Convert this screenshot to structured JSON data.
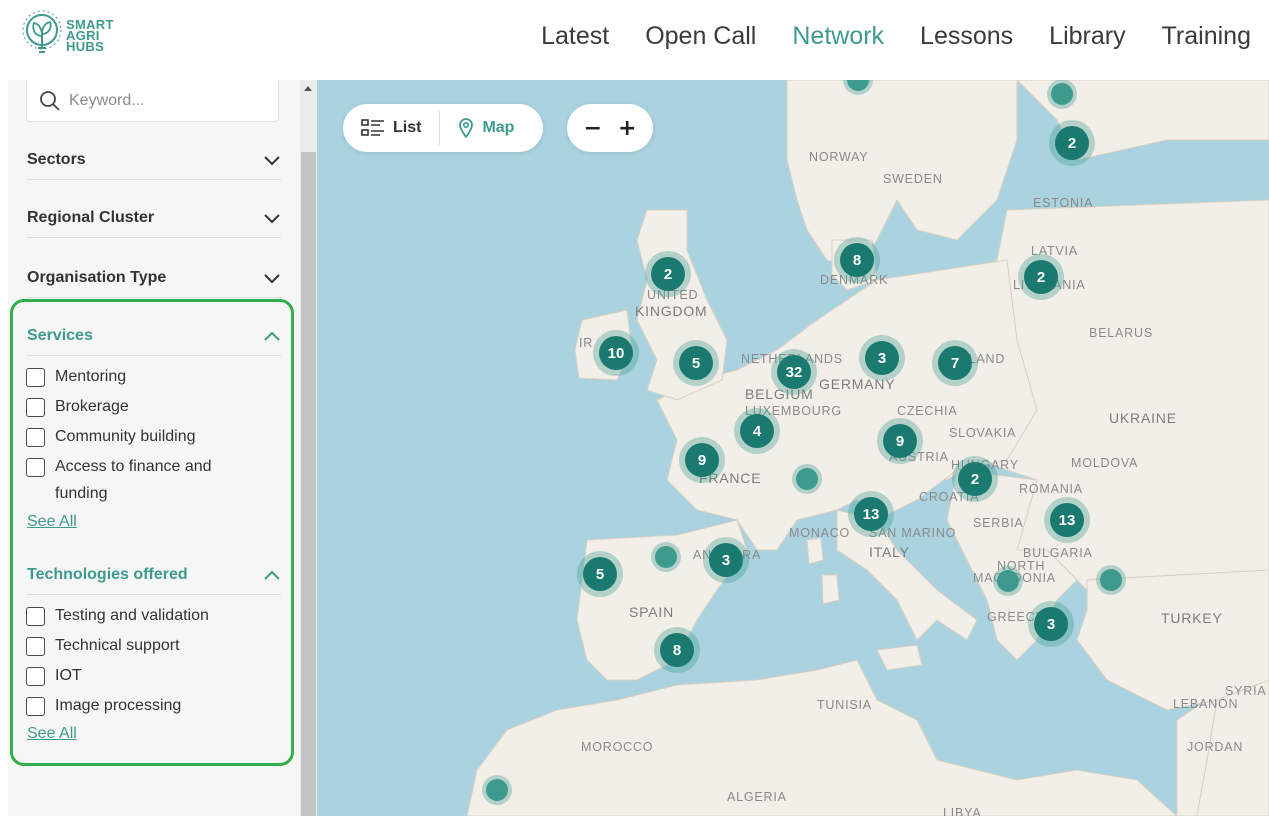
{
  "brand": {
    "line1": "SMART",
    "line2": "AGRI",
    "line3": "HUBS"
  },
  "nav": [
    {
      "label": "Latest"
    },
    {
      "label": "Open Call"
    },
    {
      "label": "Network"
    },
    {
      "label": "Lessons"
    },
    {
      "label": "Library"
    },
    {
      "label": "Training"
    }
  ],
  "nav_active": "Network",
  "search": {
    "placeholder": "Keyword..."
  },
  "filters": {
    "sectors": "Sectors",
    "regional_cluster": "Regional Cluster",
    "organisation_type": "Organisation Type",
    "services": {
      "title": "Services",
      "options": [
        "Mentoring",
        "Brokerage",
        "Community building",
        "Access to finance and funding"
      ],
      "see_all": "See All"
    },
    "technologies": {
      "title": "Technologies offered",
      "options": [
        "Testing and validation",
        "Technical support",
        "IOT",
        "Image processing"
      ],
      "see_all": "See All"
    }
  },
  "view_toggle": {
    "list": "List",
    "map": "Map"
  },
  "zoom": {
    "out": "−",
    "in": "+"
  },
  "map_labels": {
    "norway": "NORWAY",
    "sweden": "SWEDEN",
    "estonia": "ESTONIA",
    "latvia": "LATVIA",
    "united": "UNITED",
    "kingdom": "KINGDOM",
    "ireland": "IR",
    "belarus": "BELARUS",
    "denmark": "DENMARK",
    "netherlands": "NETHERLANDS",
    "germany": "GERMANY",
    "belgium": "BELGIUM",
    "luxembourg": "LUXEMBOURG",
    "poland": "POLAND",
    "lithuania": "LITHUANIA",
    "czechia": "CZECHIA",
    "slovakia": "SLOVAKIA",
    "ukraine": "UKRAINE",
    "moldova": "MOLDOVA",
    "france": "FRANCE",
    "austria": "AUSTRIA",
    "hungary": "HUNGARY",
    "romania": "ROMANIA",
    "croatia": "CROATIA",
    "serbia": "SERBIA",
    "monaco": "MONACO",
    "san_marino": "SAN MARINO",
    "italy": "ITALY",
    "bulgaria": "BULGARIA",
    "north": "NORTH",
    "macedonia": "MACEDONIA",
    "andorra": "ANDORRA",
    "spain": "SPAIN",
    "greece": "GREECE",
    "turkey": "TURKEY",
    "syria": "SYRIA",
    "lebanon": "LEBANON",
    "tunisia": "TUNISIA",
    "morocco": "MOROCCO",
    "jordan": "JORDAN",
    "algeria": "ALGERIA",
    "libya": "LIBYA"
  },
  "clusters": [
    "2",
    "2",
    "8",
    "2",
    "10",
    "5",
    "32",
    "3",
    "7",
    "4",
    "9",
    "9",
    "2",
    "13",
    "13",
    "3",
    "5",
    "8",
    "3"
  ],
  "colors": {
    "accent": "#3f9a8e",
    "marker": "#1b7a70",
    "highlight": "#2fb04a",
    "sea": "#aad3df",
    "land": "#f2efe9"
  }
}
